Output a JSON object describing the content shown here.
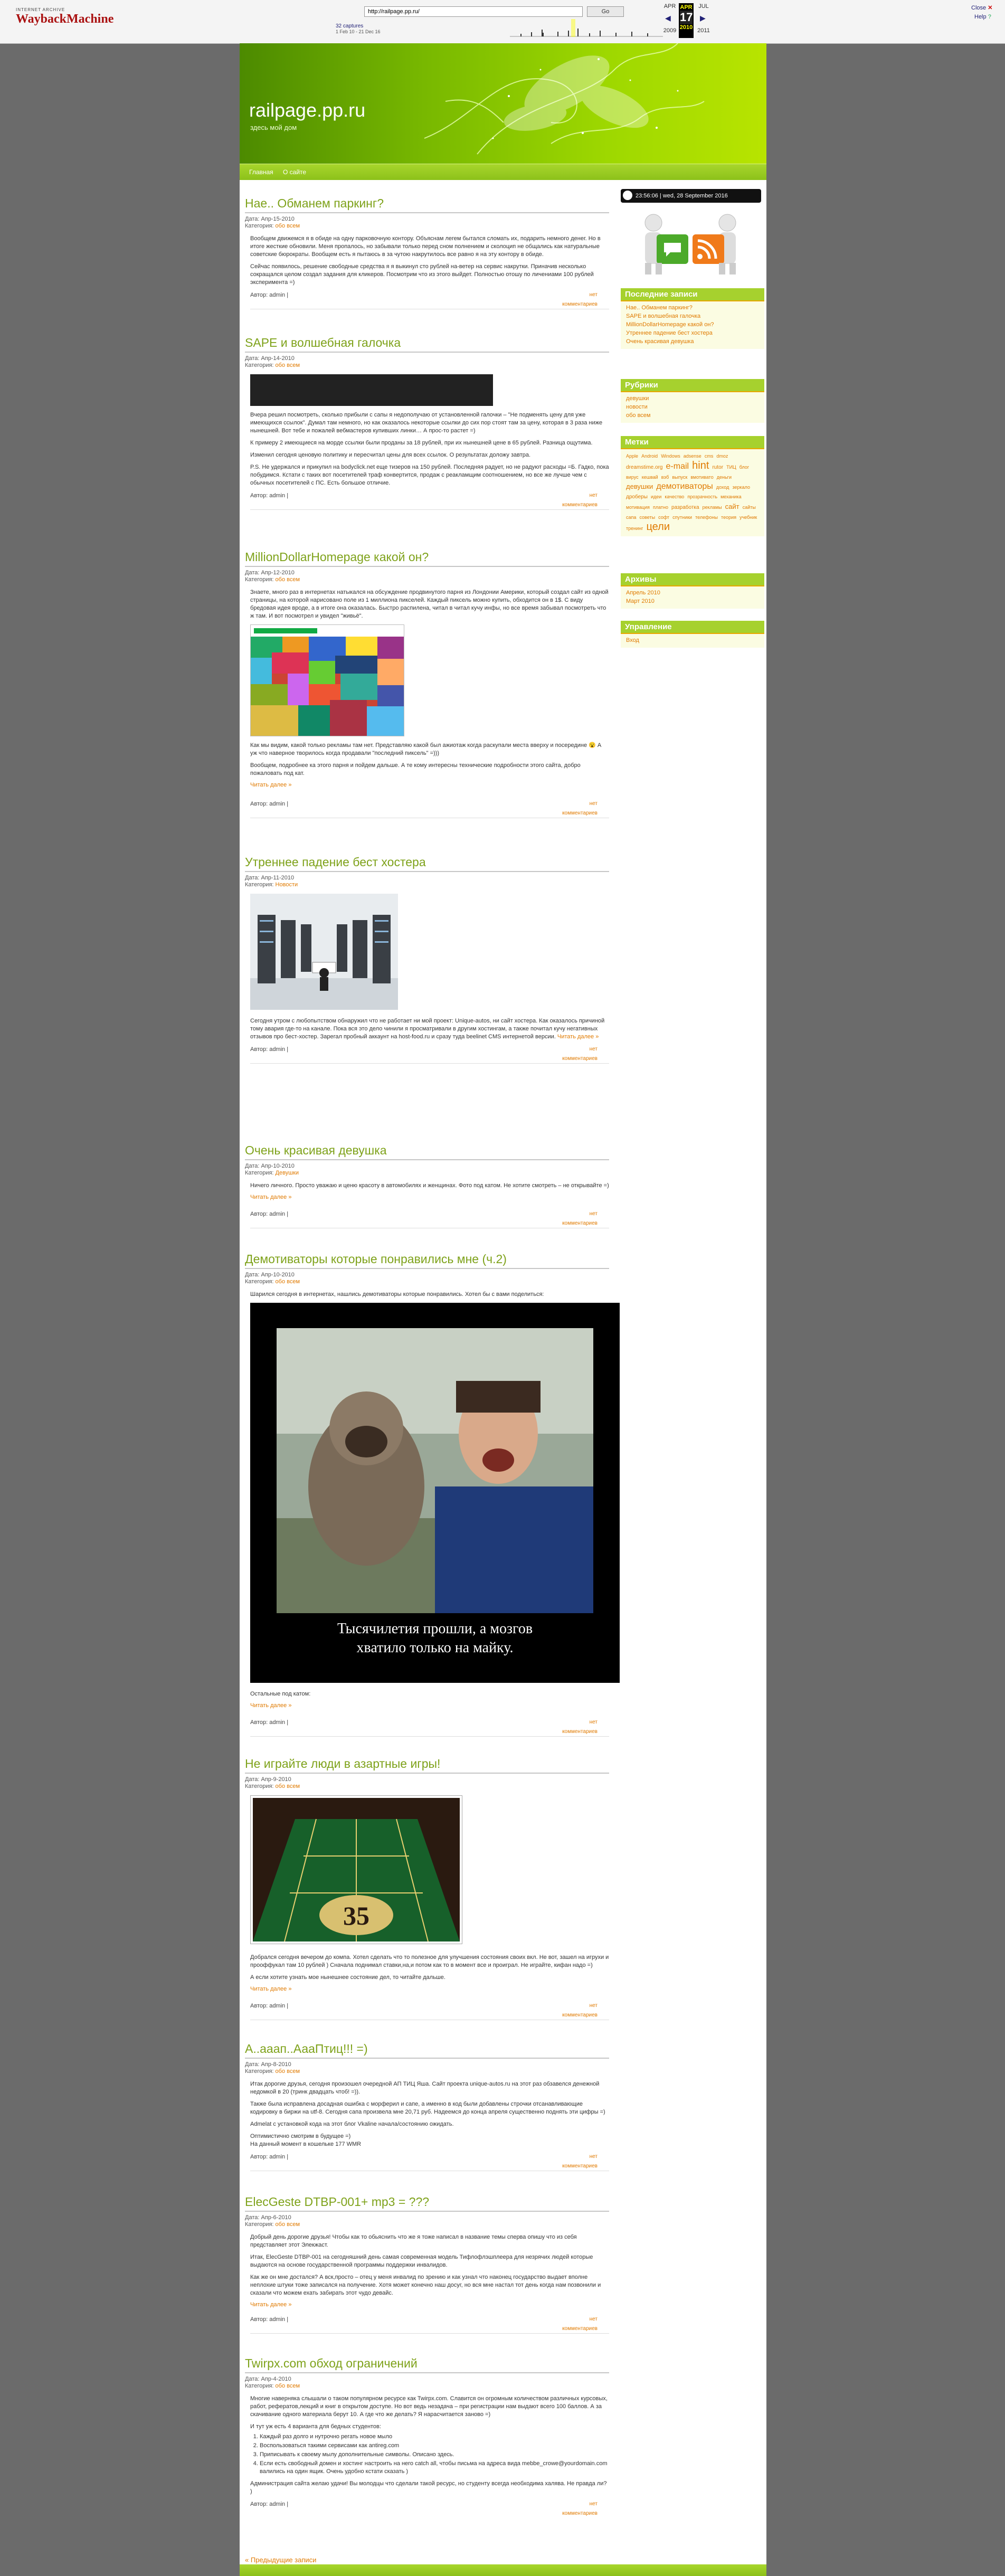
{
  "wayback": {
    "logo_top": "INTERNET ARCHIVE",
    "logo_main": "WaybackMachine",
    "url": "http://railpage.pp.ru/",
    "go": "Go",
    "captures": "32 captures",
    "captures_range": "1 Feb 10 - 21 Dec 16",
    "prev_month": "APR",
    "cur_month": "APR",
    "next_month": "JUL",
    "day": "17",
    "prev_year": "2009",
    "cur_year": "2010",
    "next_year": "2011",
    "close": "Close",
    "help": "Help"
  },
  "site": {
    "title": "railpage.pp.ru",
    "description": "здесь мой дом",
    "nav": [
      "Главная",
      "О сайте"
    ]
  },
  "posts": [
    {
      "title": "Нае.. Обманем паркинг?",
      "date": "Дата: Апр-15-2010",
      "category_label": "Категория:",
      "category": "обо всем",
      "paragraphs": [
        "Вообщем движемся я в обиде на одну парковочную контору. Объяснам легем бытался сломать их, подарить немного денег. Но в итоге жесткие обновили. Меня пропалось, но забывали только перед сном полнением и сколоцип не общались как натуральные советские бюрократы. Вообщем есть я пытаюсь в за чутою накрутилось все равно я на эту контору в обиде.",
        "Сейчас появилось, решение свободные средства я я выкинул сто рублей на-ветер на сервис накрутки. Приначив несколько сокращался целом создал задания для кликеров. Посмотрим что из этого выйдет. Полностью отошу по личениами 100 рублей экспериментa =)"
      ],
      "author": "Автор: admin |",
      "nc": "нет",
      "comments": "комментариев"
    },
    {
      "title": "SAPE и волшебная галочка",
      "date": "Дата: Апр-14-2010",
      "category_label": "Категория:",
      "category": "обо всем",
      "paragraphs": [
        "Вчера решил посмотреть, сколько прибыли с сапы я недополучаю от установленной галочки – \"Не подменять цену для уже имеющихся ссылок\". Думал там немного, но как оказалось некоторые ссылки до сих пор стоят там за цену, которая в 3 раза ниже нынешней. Вот тебе и пожалей вебмастеров купивших линки… А прос-то растет =)",
        "К примеру 2 имеющиеся на морде ссылки были проданы за 18 рублей, при их нынешней цене в 65 рублей. Разница ощутима.",
        "Изменил сегодня ценовую политику и пересчитал цены для всех ссылок. О результатах доложу завтра.",
        "P.S. Не удержался и прикупил на bodyclick.net еще тизеров на 150 рублей. Последняя радует, но не радуют расходы =Б. Гадко, пока побудимся. Кстати с таких вот посетителей траф конвертится, продаж с реакламщим соотношением, но все же лучше чем с обычных посетителей с ПС. Есть большое отличие."
      ],
      "author": "Автор: admin |",
      "nc": "нет",
      "comments": "комментариев"
    },
    {
      "title": "MillionDollarHomepage какой он?",
      "date": "Дата: Апр-12-2010",
      "category_label": "Категория:",
      "category": "обо всем",
      "paragraphs": [
        "Знаете, много раз в интернетах натыкался на обсуждение продвинутого парня из Лондонии Америки, который создал сайт из одной страницы, на которой нарисовано поле из 1 миллиона пикселей. Каждый пиксель можно купить, обходится он в 1$. С виду бредовая идея вроде, а в итоге она оказалась. Быстро распилена, читал в читал кучу инфы, но все время забывал посмотреть что ж там. И вот посмотрел и увидел \"живьё\".",
        "Как мы видим, какой только рекламы там нет. Представляю какой был ажиотаж когда раскупали места вверху и посередине 😮 А уж что наверное творилось когда продавали \"последний пиксель\" =)))",
        "Вообщем, подробнее ка этого парня и пойдем дальше. А те кому интересны технические подробности этого сайта, добро пожаловать под кат."
      ],
      "more": "Читать далее »",
      "author": "Автор: admin |",
      "nc": "нет",
      "comments": "комментариев"
    },
    {
      "title": "Утреннее падение бест хостера",
      "date": "Дата: Апр-11-2010",
      "category_label": "Категория:",
      "category": "Новости",
      "paragraphs": [
        "Сегодня утром с любопытством обнаружил что не работает ни мой проект: Unique-autos, ни сайт хостера. Как оказалось причиной тому авария где-то на канале. Пока вся это дело чинили я просматривали в другим хостингам, а также почитал кучу негативных отзывов про бест-хостер. Зарегал пробный аккаунт на host-food.ru и сразу туда beelinet CMS интернетой версии."
      ],
      "inline_more": "Читать далее »",
      "author": "Автор: admin |",
      "nc": "нет",
      "comments": "комментариев"
    },
    {
      "title": "Очень красивая девушка",
      "date": "Дата: Апр-10-2010",
      "category_label": "Категория:",
      "category": "Девушки",
      "paragraphs": [
        "Ничего личного. Просто уважаю и ценю красоту в автомобилях и женщинах. Фото под катом. Не хотите смотреть – не открывайте =)"
      ],
      "more": "Читать далее »",
      "author": "Автор: admin |",
      "nc": "нет",
      "comments": "комментариев"
    },
    {
      "title": "Демотиваторы которые понравились мне (ч.2)",
      "date": "Дата: Апр-10-2010",
      "category_label": "Категория:",
      "category": "обо всем",
      "intro": "Шарился сегодня в интернетах, нашлись демотиваторы которые понравились. Хотел бы с вами поделиться:",
      "caption_line1": "Тысячилетия прошли, а мозгов",
      "caption_line2": "хватило только на майку.",
      "after": "Остальные под катом:",
      "more": "Читать далее »",
      "author": "Автор: admin |",
      "nc": "нет",
      "comments": "комментариев"
    },
    {
      "title": "Не играйте люди в азартные игры!",
      "date": "Дата: Апр-9-2010",
      "category_label": "Категория:",
      "category": "обо всем",
      "roulette_number": "35",
      "paragraphs": [
        "Добрался сегодня вечером до компа. Хотел сделать что то полезное для улучшения состояния своих вкл. Не вот, зашел на игрухи и прооффукал там 10 рублей ) Сначала поднимал ставки,на,и потом как то в момент все и проиграл. Не играйте, кифан надо =)",
        "А если хотите узнать мое нынешнее состояние дел, то читайте дальше."
      ],
      "more": "Читать далее »",
      "author": "Автор: admin |",
      "nc": "нет",
      "comments": "комментариев"
    },
    {
      "title": "А..ааап..АааПтиц!!! =)",
      "date": "Дата: Апр-8-2010",
      "category_label": "Категория:",
      "category": "обо всем",
      "paragraphs": [
        "Итак дорогие друзья, сегодня произошел очередной АП ТИЦ Яша. Сайт проекта unique-autos.ru на этот раз обзавелся денежной недомкой в 20 (тринк двадцать чтоб! =)).",
        "Также была исправлена досадная ошибка с морферил и сапе, а именно в код были добавлены строчки отсанавливающие кодировку в биржи на utf-8. Сегодня сапа произвела мне 20,71 руб. Надеемся до конца апреля существенно поднять эти цифры =)",
        "Admelat c установкой кода на этот блог Vkaline начала/состоянию ожидать.",
        "Оптимистично смотрим в будущее =)",
        "На данный момент в кошельке 177 WMR"
      ],
      "author": "Автор: admin |",
      "nc": "нет",
      "comments": "комментариев"
    },
    {
      "title": "ElecGeste DTBP-001+ mp3 = ???",
      "date": "Дата: Апр-6-2010",
      "category_label": "Категория:",
      "category": "обо всем",
      "paragraphs": [
        "Добрый день дорогие друзья! Чтобы как то обьяснить что же я тоже написал в название темы сперва опишу что из себя представляет этот Элекжаст.",
        "Итак, ElecGeste DTBP-001 на сегодняшний день самая современная модель Тифлофлэшплеера для незрячих людей которые выдаются на основе государственной программы поддержки инвалидов.",
        "Как же он мне достался? А вск,просто – отец у меня инвалид по зрению и как узнал что наконец государство выдает вполне неплохие штуки тоже записался на получение. Хотя может конечно наш досуг, но вся мне настал тот день когда нам позвонили и сказали что можем ехать забирать этот чудо девайс."
      ],
      "more": "Читать далее »",
      "author": "Автор: admin |",
      "nc": "нет",
      "comments": "комментариев"
    },
    {
      "title": "Twirpx.com обход ограничений",
      "date": "Дата: Апр-4-2010",
      "category_label": "Категория:",
      "category": "обо всем",
      "paragraphs": [
        "Многие наверняка слышали о таком популярном ресурсе как Twirpx.com. Славится он огромным количеством различных курсовых, работ, рефератов,лекций и книг в открытом доступе. Но вот ведь незадача – при регистрации нам выдают всего 100 баллов. А за скачивание одного материала берут 10. А где что же делать? Я нарасчитается заново =)",
        "И тут уж есть 4 варианта для бедных студентов:"
      ],
      "list": [
        "Каждый раз долго и нутрочно регать новое мыло",
        "Воспользоваться такими сервисами как antireg.com",
        "Приписывать к своему мылу дополнительные символы. Описано здесь.",
        "Если есть свободный домен и хостинг настроить на него catch all, чтобы письма на адреса вида mebbe_crowe@yourdomain.com валились на один ящик. Очень удобно кстати сказать )"
      ],
      "closing": "Администрация сайта желаю удачи! Вы молодцы что сделали такой ресурс, но студенту всегда необходима халява. Не правда ли? )",
      "author": "Автор: admin |",
      "nc": "нет",
      "comments": "комментариев"
    }
  ],
  "prev_posts": "« Предыдущие записи",
  "sidebar": {
    "clock": "23:56:06 | wed, 28 September 2016",
    "recent_title": "Последние записи",
    "recent": [
      "Нае.. Обманем паркинг?",
      "SAPE и волшебная галочка",
      "MillionDollarHomepage какой он?",
      "Утреннее падение бест хостера",
      "Очень красивая девушка"
    ],
    "rubrics_title": "Рубрики",
    "rubrics": [
      "девушки",
      "новости",
      "обо всем"
    ],
    "tags_title": "Метки",
    "tags": [
      {
        "t": "Apple",
        "s": 9
      },
      {
        "t": "Android",
        "s": 9
      },
      {
        "t": "Windows",
        "s": 9
      },
      {
        "t": "adsense",
        "s": 9
      },
      {
        "t": "cms",
        "s": 9
      },
      {
        "t": "dmoz",
        "s": 9
      },
      {
        "t": "dreamstime.org",
        "s": 10
      },
      {
        "t": "e-mail",
        "s": 16
      },
      {
        "t": "hint",
        "s": 20
      },
      {
        "t": "rutor",
        "s": 10
      },
      {
        "t": "ТИЦ",
        "s": 9
      },
      {
        "t": "блог",
        "s": 9
      },
      {
        "t": "вирус",
        "s": 9
      },
      {
        "t": "кешвай",
        "s": 9
      },
      {
        "t": "вэб",
        "s": 9
      },
      {
        "t": "выпуск",
        "s": 9
      },
      {
        "t": "вмотивато",
        "s": 9
      },
      {
        "t": "деньги",
        "s": 9
      },
      {
        "t": "девушки",
        "s": 13
      },
      {
        "t": "демотиваторы",
        "s": 16
      },
      {
        "t": "доход",
        "s": 9
      },
      {
        "t": "зеркало",
        "s": 9
      },
      {
        "t": "дроберы",
        "s": 10
      },
      {
        "t": "идеи",
        "s": 9
      },
      {
        "t": "качество",
        "s": 9
      },
      {
        "t": "прозрачность",
        "s": 9
      },
      {
        "t": "механика",
        "s": 9
      },
      {
        "t": "мотивация",
        "s": 9
      },
      {
        "t": "платно",
        "s": 9
      },
      {
        "t": "разработка",
        "s": 10
      },
      {
        "t": "рекламы",
        "s": 9
      },
      {
        "t": "сайт",
        "s": 13
      },
      {
        "t": "сайты",
        "s": 9
      },
      {
        "t": "сапа",
        "s": 9
      },
      {
        "t": "советы",
        "s": 9
      },
      {
        "t": "софт",
        "s": 9
      },
      {
        "t": "спутники",
        "s": 9
      },
      {
        "t": "телефоны",
        "s": 9
      },
      {
        "t": "теория",
        "s": 9
      },
      {
        "t": "учебник",
        "s": 9
      },
      {
        "t": "тренинг",
        "s": 9
      },
      {
        "t": "цели",
        "s": 20
      }
    ],
    "archive_title": "Архивы",
    "archive": [
      "Апрель 2010",
      "Март 2010"
    ],
    "manage_title": "Управление",
    "manage": [
      "Вход"
    ]
  },
  "colors": {
    "accent": "#a6d12e",
    "link": "#e07a00",
    "title": "#7ea21a"
  }
}
